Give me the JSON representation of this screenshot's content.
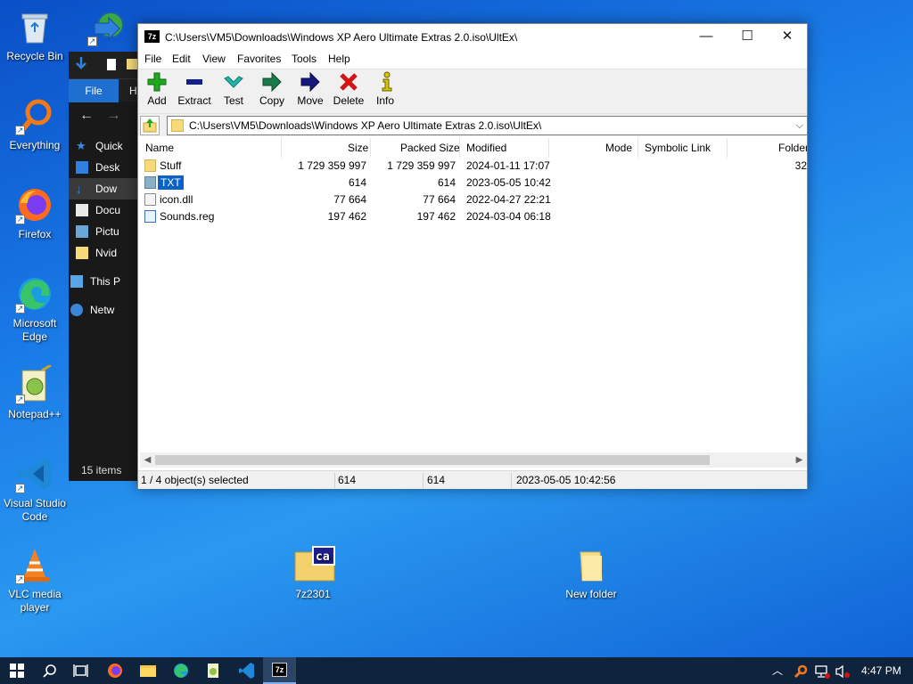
{
  "desktop": {
    "icons": [
      {
        "label": "Recycle Bin"
      },
      {
        "label": "Everything"
      },
      {
        "label": "Firefox"
      },
      {
        "label": "Microsoft Edge"
      },
      {
        "label": "Notepad++"
      },
      {
        "label": "Visual Studio Code"
      },
      {
        "label": "VLC media player"
      },
      {
        "label": "7z2301"
      },
      {
        "label": "New folder"
      }
    ]
  },
  "explorer": {
    "ribbon_file": "File",
    "ribbon_home": "H",
    "tree": [
      {
        "label": "Quick"
      },
      {
        "label": "Desk"
      },
      {
        "label": "Dow"
      },
      {
        "label": "Docu"
      },
      {
        "label": "Pictu"
      },
      {
        "label": "Nvid"
      },
      {
        "label": "This P"
      },
      {
        "label": "Netw"
      }
    ],
    "status": "15 items"
  },
  "window": {
    "app_icon": "7z",
    "title": "C:\\Users\\VM5\\Downloads\\Windows XP Aero Ultimate Extras 2.0.iso\\UltEx\\",
    "minimize": "—",
    "maximize": "☐",
    "close": "✕",
    "menu": [
      "File",
      "Edit",
      "View",
      "Favorites",
      "Tools",
      "Help"
    ],
    "toolbar": [
      {
        "label": "Add",
        "icon": "plus-icon",
        "color": "#1fa81f"
      },
      {
        "label": "Extract",
        "icon": "minus-icon",
        "color": "#10208c"
      },
      {
        "label": "Test",
        "icon": "check-arrow-icon",
        "color": "#22b5a8"
      },
      {
        "label": "Copy",
        "icon": "right-arrow-icon",
        "color": "#1a7a4a"
      },
      {
        "label": "Move",
        "icon": "right-arrow-icon",
        "color": "#14187a"
      },
      {
        "label": "Delete",
        "icon": "x-icon",
        "color": "#d21414"
      },
      {
        "label": "Info",
        "icon": "info-icon",
        "color": "#d6c400"
      }
    ],
    "path": "C:\\Users\\VM5\\Downloads\\Windows XP Aero Ultimate Extras 2.0.iso\\UltEx\\",
    "columns": [
      "Name",
      "Size",
      "Packed Size",
      "Modified",
      "Mode",
      "Symbolic Link",
      "Folder"
    ],
    "rows": [
      {
        "name": "Stuff",
        "size": "1 729 359 997",
        "packed": "1 729 359 997",
        "modified": "2024-01-11 17:07",
        "folders": "32",
        "type": "folder"
      },
      {
        "name": "TXT",
        "size": "614",
        "packed": "614",
        "modified": "2023-05-05 10:42",
        "folders": "",
        "type": "file",
        "selected": true
      },
      {
        "name": "icon.dll",
        "size": "77 664",
        "packed": "77 664",
        "modified": "2022-04-27 22:21",
        "folders": "",
        "type": "dll"
      },
      {
        "name": "Sounds.reg",
        "size": "197 462",
        "packed": "197 462",
        "modified": "2024-03-04 06:18",
        "folders": "",
        "type": "reg"
      }
    ],
    "status": {
      "selection": "1 / 4 object(s) selected",
      "size": "614",
      "packed": "614",
      "modified": "2023-05-05 10:42:56"
    }
  },
  "taskbar": {
    "clock": "4:47 PM",
    "accent": "#10233d"
  }
}
